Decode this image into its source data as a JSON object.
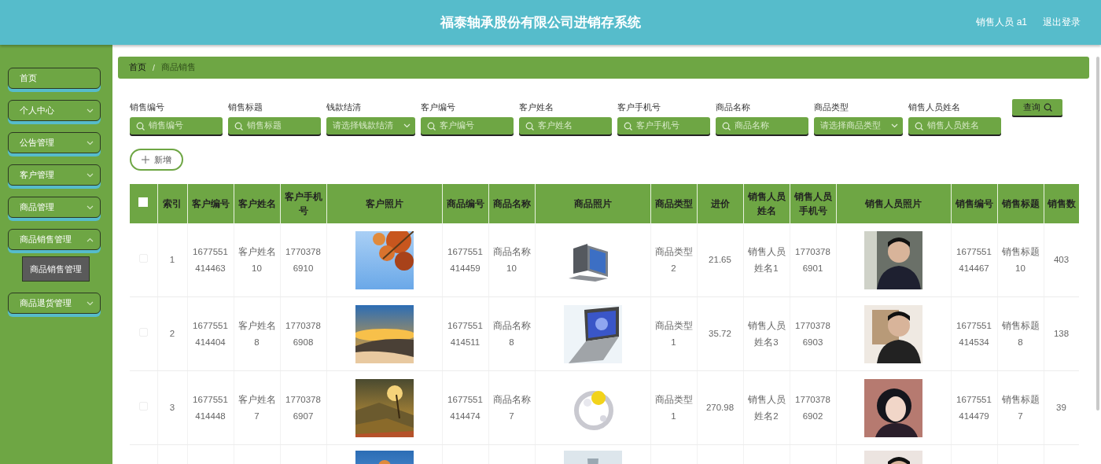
{
  "header": {
    "title": "福泰轴承股份有限公司进销存系统",
    "user": "销售人员 a1",
    "logout": "退出登录"
  },
  "sidebar": {
    "items": [
      {
        "label": "首页",
        "kind": "link",
        "expanded": false
      },
      {
        "label": "个人中心",
        "kind": "group",
        "expanded": false
      },
      {
        "label": "公告管理",
        "kind": "group",
        "expanded": false
      },
      {
        "label": "客户管理",
        "kind": "group",
        "expanded": false
      },
      {
        "label": "商品管理",
        "kind": "group",
        "expanded": false
      },
      {
        "label": "商品销售管理",
        "kind": "group",
        "expanded": true,
        "children": [
          {
            "label": "商品销售管理",
            "selected": true
          }
        ]
      },
      {
        "label": "商品退货管理",
        "kind": "group",
        "expanded": false
      }
    ]
  },
  "breadcrumb": {
    "separator": "/",
    "items": [
      {
        "label": "首页",
        "current": false
      },
      {
        "label": "商品销售",
        "current": true
      }
    ]
  },
  "search": {
    "fields": [
      {
        "label": "销售编号",
        "placeholder": "销售编号",
        "kind": "text"
      },
      {
        "label": "销售标题",
        "placeholder": "销售标题",
        "kind": "text"
      },
      {
        "label": "钱款结清",
        "placeholder": "请选择钱款结清",
        "kind": "select"
      },
      {
        "label": "客户编号",
        "placeholder": "客户编号",
        "kind": "text"
      },
      {
        "label": "客户姓名",
        "placeholder": "客户姓名",
        "kind": "text"
      },
      {
        "label": "客户手机号",
        "placeholder": "客户手机号",
        "kind": "text"
      },
      {
        "label": "商品名称",
        "placeholder": "商品名称",
        "kind": "text"
      },
      {
        "label": "商品类型",
        "placeholder": "请选择商品类型",
        "kind": "select"
      },
      {
        "label": "销售人员姓名",
        "placeholder": "销售人员姓名",
        "kind": "text"
      }
    ],
    "button": "查询"
  },
  "add_button": "新增",
  "table": {
    "select_all_checked": false,
    "columns": [
      {
        "label": "索引",
        "kind": "text"
      },
      {
        "label": "客户编号",
        "kind": "text"
      },
      {
        "label": "客户姓名",
        "kind": "text"
      },
      {
        "label": "客户手机号",
        "kind": "text"
      },
      {
        "label": "客户照片",
        "kind": "picture"
      },
      {
        "label": "商品编号",
        "kind": "text"
      },
      {
        "label": "商品名称",
        "kind": "text"
      },
      {
        "label": "商品照片",
        "kind": "picture"
      },
      {
        "label": "商品类型",
        "kind": "text"
      },
      {
        "label": "进价",
        "kind": "text"
      },
      {
        "label": "销售人员姓名",
        "kind": "text"
      },
      {
        "label": "销售人员手机号",
        "kind": "text"
      },
      {
        "label": "销售人员照片",
        "kind": "picture"
      },
      {
        "label": "销售编号",
        "kind": "text"
      },
      {
        "label": "销售标题",
        "kind": "text"
      },
      {
        "label": "销售数",
        "kind": "text"
      }
    ],
    "rows": [
      {
        "kind": "full",
        "selected": false,
        "cells": [
          "1",
          "1677551414463",
          "客户姓名10",
          "17703786910",
          "1677551414459",
          "商品名称10",
          "商品类型2",
          "21.65",
          "销售人员姓名1",
          "17703786901",
          "1677551414467",
          "销售标题10",
          "403"
        ]
      },
      {
        "kind": "full",
        "selected": false,
        "cells": [
          "2",
          "1677551414404",
          "客户姓名8",
          "17703786908",
          "1677551414511",
          "商品名称8",
          "商品类型1",
          "35.72",
          "销售人员姓名3",
          "17703786903",
          "1677551414534",
          "销售标题8",
          "138"
        ]
      },
      {
        "kind": "full",
        "selected": false,
        "cells": [
          "3",
          "1677551414448",
          "客户姓名7",
          "17703786907",
          "1677551414474",
          "商品名称7",
          "商品类型1",
          "270.98",
          "销售人员姓名2",
          "17703786902",
          "1677551414479",
          "销售标题7",
          "39"
        ]
      },
      {
        "kind": "partial",
        "selected": false
      }
    ]
  }
}
